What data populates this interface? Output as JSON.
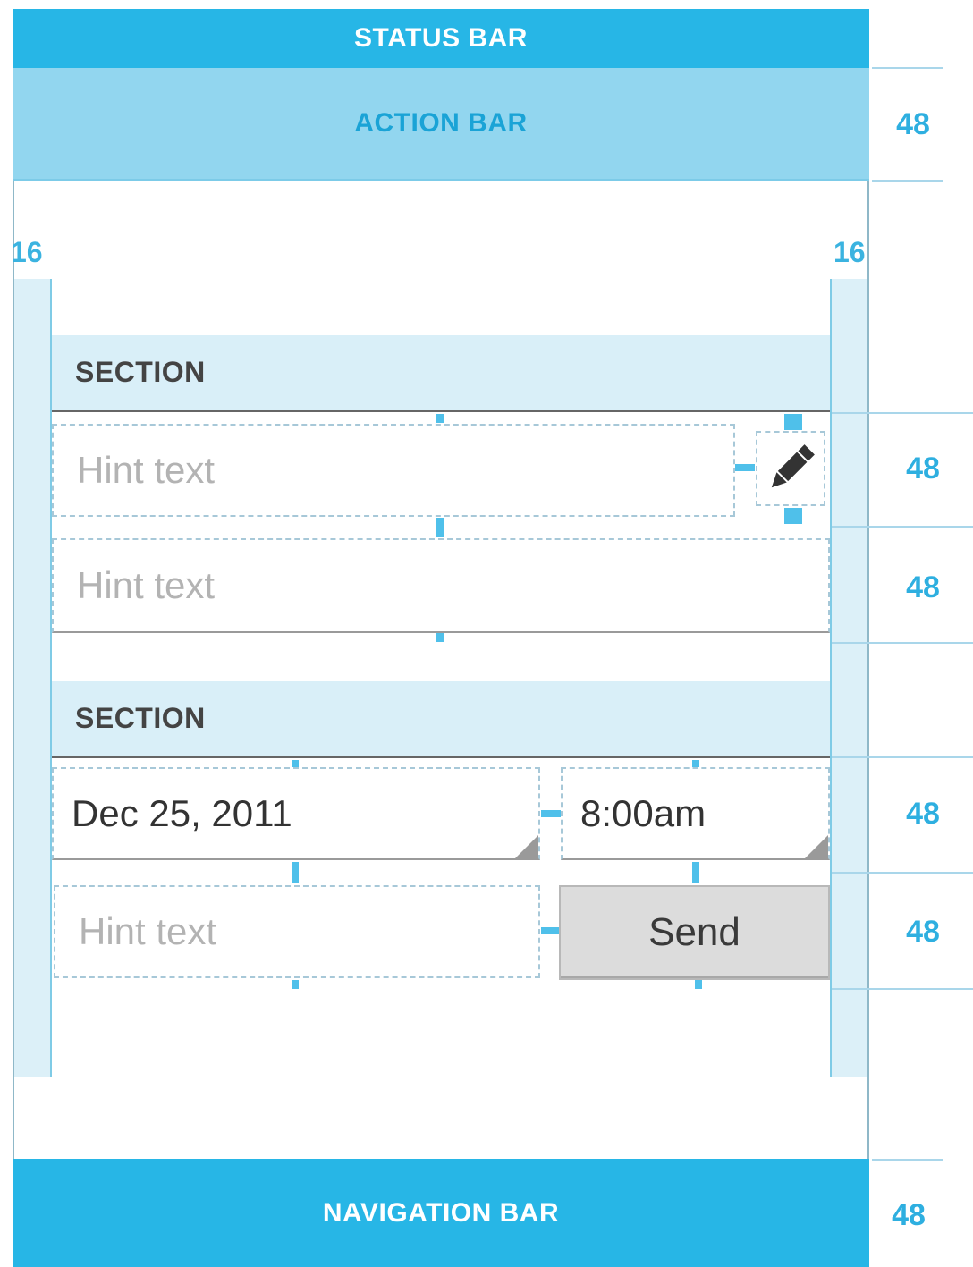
{
  "system": {
    "status_bar_label": "STATUS BAR",
    "action_bar_label": "ACTION BAR",
    "navigation_bar_label": "NAVIGATION BAR"
  },
  "margins": {
    "left": "16",
    "right": "16"
  },
  "dimensions": {
    "action_bar": "48",
    "row1": "48",
    "row2": "48",
    "row3": "48",
    "row4": "48",
    "navigation_bar": "48"
  },
  "sections": [
    {
      "title": "SECTION"
    },
    {
      "title": "SECTION"
    }
  ],
  "fields": {
    "hint1": "Hint text",
    "hint2": "Hint text",
    "date": "Dec 25, 2011",
    "time": "8:00am",
    "message_hint": "Hint text"
  },
  "buttons": {
    "send": "Send"
  },
  "icons": {
    "edit": "pencil-icon"
  },
  "colors": {
    "system_bar": "#27b6e6",
    "action_bar": "#92d6ef",
    "section_bg": "#d9eff8",
    "accent": "#2eafe0"
  }
}
